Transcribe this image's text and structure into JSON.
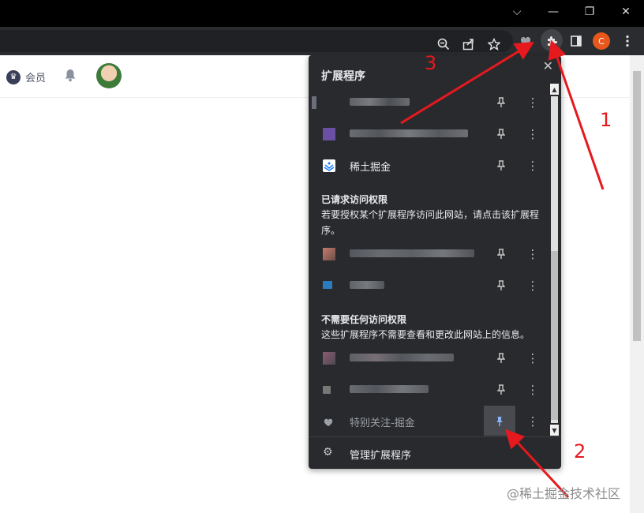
{
  "window": {
    "controls": {
      "chevron": "⌵",
      "minimize": "—",
      "restore": "❐",
      "close": "✕"
    }
  },
  "toolbar": {
    "zoom_icon": "zoom-out-icon",
    "share_icon": "share-icon",
    "bookmark_icon": "star-icon",
    "extension_pinned_icon": "heart-extension-icon",
    "extensions_icon": "puzzle-icon",
    "sidepanel_icon": "side-panel-icon",
    "profile_letter": "C",
    "menu_icon": "kebab-menu-icon",
    "profile_color": "#e8571c"
  },
  "page": {
    "vip_label": "会员",
    "bell_icon": "bell-icon",
    "avatar": "user-avatar"
  },
  "popup": {
    "title": "扩展程序",
    "close_glyph": "✕",
    "full_access_extensions": [
      {
        "name": "",
        "blurred": true,
        "icon_color": "#6b6f7a"
      },
      {
        "name": "",
        "blurred": true,
        "icon_color": "#6a4fa3"
      },
      {
        "name": "稀土掘金",
        "blurred": false,
        "icon_color": "#1e80ff"
      }
    ],
    "requested_section": {
      "title": "已请求访问权限",
      "description": "若要授权某个扩展程序访问此网站，请点击该扩展程序。",
      "extensions": [
        {
          "name": "",
          "blurred": true,
          "icon_color": "#c87a6a"
        },
        {
          "name": "",
          "blurred": true,
          "icon_color": "#2b7bbf"
        }
      ]
    },
    "no_access_section": {
      "title": "不需要任何访问权限",
      "description": "这些扩展程序不需要查看和更改此网站上的信息。",
      "extensions": [
        {
          "name": "",
          "blurred": true,
          "icon_color": "#8a5a6e"
        },
        {
          "name": "",
          "blurred": true,
          "icon_color": "#777777"
        },
        {
          "name": "特别关注-掘金",
          "blurred": false,
          "icon_color": "#9aa0a6",
          "pinned": true
        }
      ]
    },
    "manage_label": "管理扩展程序",
    "pin_glyph": "📌",
    "more_glyph": "⋮",
    "gear_glyph": "⚙"
  },
  "annotations": {
    "labels": [
      "1",
      "2",
      "3"
    ],
    "color": "#e5191e"
  },
  "watermark": "@稀土掘金技术社区"
}
